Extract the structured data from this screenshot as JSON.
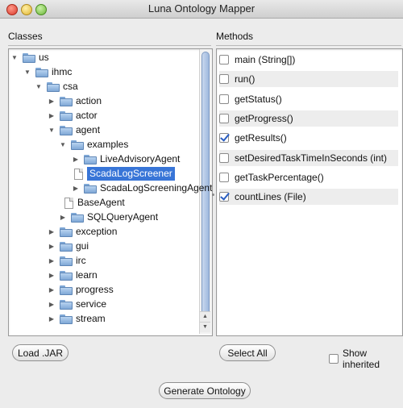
{
  "window": {
    "title": "Luna Ontology Mapper"
  },
  "classes": {
    "label": "Classes",
    "tree": [
      {
        "label": "us",
        "type": "folder",
        "expanded": true
      },
      {
        "label": "ihmc",
        "type": "folder",
        "expanded": true
      },
      {
        "label": "csa",
        "type": "folder",
        "expanded": true
      },
      {
        "label": "action",
        "type": "folder",
        "expanded": false
      },
      {
        "label": "actor",
        "type": "folder",
        "expanded": false
      },
      {
        "label": "agent",
        "type": "folder",
        "expanded": true
      },
      {
        "label": "examples",
        "type": "folder",
        "expanded": true
      },
      {
        "label": "LiveAdvisoryAgent",
        "type": "folder",
        "expanded": false
      },
      {
        "label": "ScadaLogScreener",
        "type": "file",
        "selected": true
      },
      {
        "label": "ScadaLogScreeningAgent",
        "type": "folder",
        "expanded": false
      },
      {
        "label": "BaseAgent",
        "type": "file"
      },
      {
        "label": "SQLQueryAgent",
        "type": "folder",
        "expanded": false
      },
      {
        "label": "exception",
        "type": "folder",
        "expanded": false
      },
      {
        "label": "gui",
        "type": "folder",
        "expanded": false
      },
      {
        "label": "irc",
        "type": "folder",
        "expanded": false
      },
      {
        "label": "learn",
        "type": "folder",
        "expanded": false
      },
      {
        "label": "progress",
        "type": "folder",
        "expanded": false
      },
      {
        "label": "service",
        "type": "folder",
        "expanded": false
      },
      {
        "label": "stream",
        "type": "folder",
        "expanded": false
      }
    ]
  },
  "methods": {
    "label": "Methods",
    "items": [
      {
        "label": "main (String[])",
        "checked": false
      },
      {
        "label": "run()",
        "checked": false
      },
      {
        "label": "getStatus()",
        "checked": false
      },
      {
        "label": "getProgress()",
        "checked": false
      },
      {
        "label": "getResults()",
        "checked": true
      },
      {
        "label": "setDesiredTaskTimeInSeconds (int)",
        "checked": false
      },
      {
        "label": "getTaskPercentage()",
        "checked": false
      },
      {
        "label": "countLines (File)",
        "checked": true
      }
    ]
  },
  "buttons": {
    "load_jar": "Load .JAR",
    "select_all": "Select All",
    "show_inherited": "Show inherited",
    "generate_ontology": "Generate Ontology"
  },
  "show_inherited_checked": false,
  "colors": {
    "selection": "#3875d7",
    "folder": "#7fa8d6",
    "check": "#2a5ec2"
  }
}
